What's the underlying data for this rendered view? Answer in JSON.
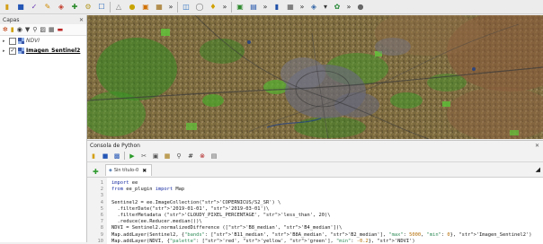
{
  "layers_panel": {
    "title": "Capas",
    "layers": [
      {
        "name": "NDVI",
        "checked": false,
        "active": false
      },
      {
        "name": "Imagen_Sentinel2",
        "checked": true,
        "active": true
      }
    ]
  },
  "console": {
    "title": "Consola de Python",
    "tab_label": "Sin título-0",
    "line_numbers": [
      "1",
      "2",
      "3",
      "4",
      "5",
      "6",
      "7",
      "8",
      "9",
      "10"
    ],
    "code_lines": [
      "import ee",
      "from ee_plugin import Map",
      "",
      "Sentinel2 = ee.ImageCollection('COPERNICUS/S2_SR') \\",
      "  .filterDate('2019-01-01', '2019-03-01')\\",
      "  .filterMetadata ('CLOUDY_PIXEL_PERCENTAGE', 'less_than', 20)\\",
      "  .reduce(ee.Reducer.median())\\",
      "NDVI = Sentinel2.normalizedDifference (['B8_median', 'B4_median'])\\",
      "Map.addLayer(Sentinel2, {\"bands\": ['B11_median', 'B8A_median', 'B2_median'], \"max\": 5000, \"min\": 0}, 'Imagen_Sentinel2')",
      "Map.addLayer(NDVI, {\"palette\": ['red', 'yellow', 'green'], \"min\": -0.2}, 'NDVI')"
    ]
  },
  "icons": {
    "toolbar": [
      "open-folder-icon",
      "save-icon",
      "digitize-icon",
      "pencil-icon",
      "node-tool-icon",
      "move-icon",
      "style-icon",
      "select-icon",
      "expand-icon",
      "identify-icon",
      "pan-icon",
      "layer-icon",
      "more-icon",
      "map-tips-icon",
      "more-icon",
      "locate-icon",
      "python-icon",
      "plugin-icon",
      "more-icon"
    ]
  },
  "colors": {
    "accent": "#3a57a8",
    "map_background": "#7b6a3f",
    "vegetation": "#2f8a1f",
    "urban": "#6a6a78"
  }
}
